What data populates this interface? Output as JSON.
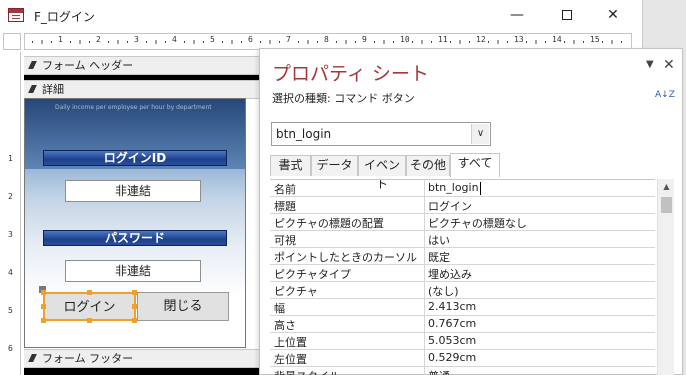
{
  "window": {
    "title": "F_ログイン",
    "min_glyph": "—",
    "close_glyph": "✕"
  },
  "ruler": {
    "h_marks": [
      "1",
      "2",
      "3",
      "4",
      "5",
      "6",
      "7",
      "8",
      "9",
      "10",
      "11",
      "12",
      "13",
      "14",
      "15"
    ],
    "v_marks": [
      "1",
      "2",
      "3",
      "4",
      "5",
      "6"
    ]
  },
  "sections": {
    "header": "フォーム ヘッダー",
    "detail": "詳細",
    "footer": "フォーム フッター"
  },
  "form": {
    "background_caption": "Daily income per employee per hour by department",
    "login_id_label": "ログインID",
    "login_id_field": "非連結",
    "password_label": "パスワード",
    "password_field": "非連結",
    "login_button": "ログイン",
    "close_button": "閉じる"
  },
  "property_sheet": {
    "title": "プロパティ シート",
    "close_glyph": "✕",
    "dropdown_glyph": "▼",
    "selection_type": "選択の種類: コマンド ボタン",
    "sort_icon_text": "A↓Z",
    "selected_control": "btn_login",
    "tabs": [
      "書式",
      "データ",
      "イベント",
      "その他",
      "すべて"
    ],
    "active_tab": "すべて",
    "properties": [
      {
        "name": "名前",
        "value": "btn_login"
      },
      {
        "name": "標題",
        "value": "ログイン"
      },
      {
        "name": "ピクチャの標題の配置",
        "value": "ピクチャの標題なし"
      },
      {
        "name": "可視",
        "value": "はい"
      },
      {
        "name": "ポイントしたときのカーソル",
        "value": "既定"
      },
      {
        "name": "ピクチャタイプ",
        "value": "埋め込み"
      },
      {
        "name": "ピクチャ",
        "value": "(なし)"
      },
      {
        "name": "幅",
        "value": "2.413cm"
      },
      {
        "name": "高さ",
        "value": "0.767cm"
      },
      {
        "name": "上位置",
        "value": "5.053cm"
      },
      {
        "name": "左位置",
        "value": "0.529cm"
      },
      {
        "name": "背景スタイル",
        "value": "普通"
      }
    ]
  }
}
